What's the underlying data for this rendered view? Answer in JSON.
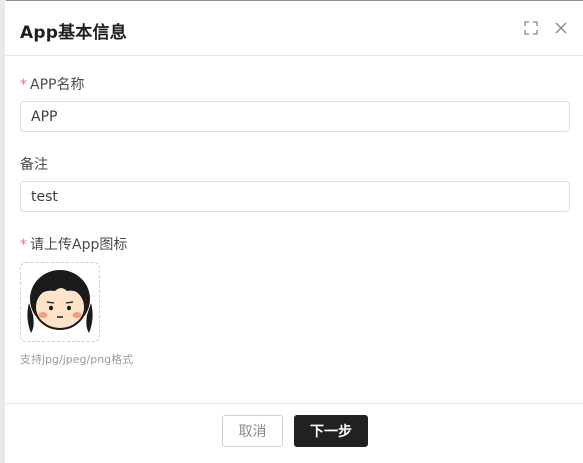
{
  "dialog": {
    "title": "App基本信息",
    "fullscreen_icon": "fullscreen-icon",
    "close_icon": "close-icon"
  },
  "form": {
    "app_name": {
      "required_mark": "*",
      "label": "APP名称",
      "value": "APP"
    },
    "remark": {
      "label": "备注",
      "value": "test"
    },
    "app_icon": {
      "required_mark": "*",
      "label": "请上传App图标",
      "hint": "支持jpg/jpeg/png格式"
    }
  },
  "footer": {
    "cancel_label": "取消",
    "next_label": "下一步"
  },
  "colors": {
    "required": "#f56c6c",
    "primary_button": "#212121",
    "border": "#dcdfe6"
  }
}
